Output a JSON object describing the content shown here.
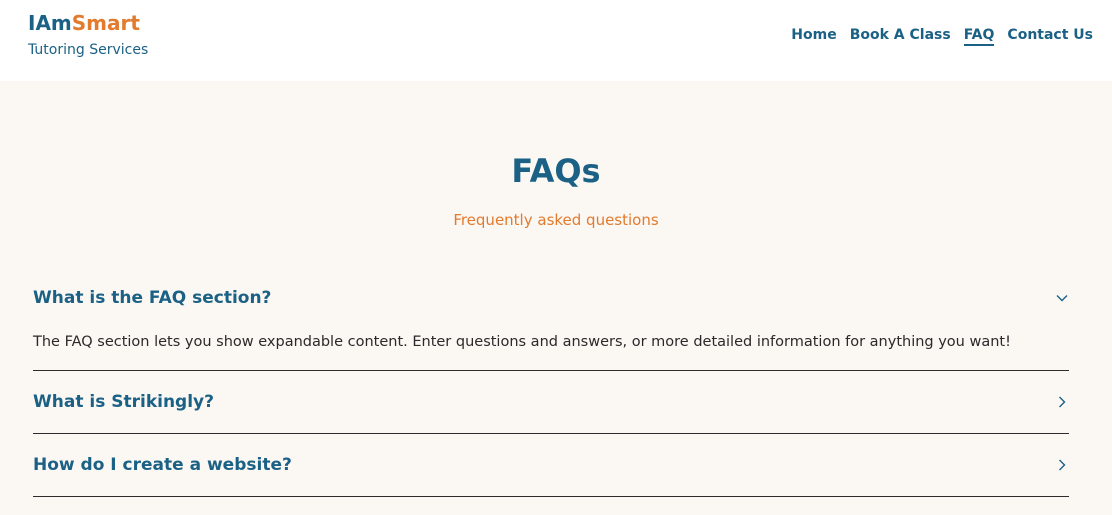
{
  "header": {
    "logo_part1": "IAm",
    "logo_part2": "Smart",
    "tagline": "Tutoring Services",
    "nav": [
      {
        "label": "Home"
      },
      {
        "label": "Book A Class"
      },
      {
        "label": "FAQ",
        "active": true
      },
      {
        "label": "Contact Us"
      }
    ]
  },
  "hero": {
    "title": "FAQs",
    "subtitle": "Frequently asked questions"
  },
  "faq": [
    {
      "question": "What is the FAQ section?",
      "answer": "The FAQ section lets you show expandable content. Enter questions and answers, or more detailed information for anything you want!",
      "expanded": true,
      "icon": "chevron-down-icon"
    },
    {
      "question": "What is Strikingly?",
      "expanded": false,
      "icon": "chevron-right-icon"
    },
    {
      "question": "How do I create a website?",
      "expanded": false,
      "icon": "chevron-right-icon"
    }
  ],
  "colors": {
    "primary": "#1b6185",
    "accent": "#e27b2e",
    "background": "#fbf7f3"
  }
}
